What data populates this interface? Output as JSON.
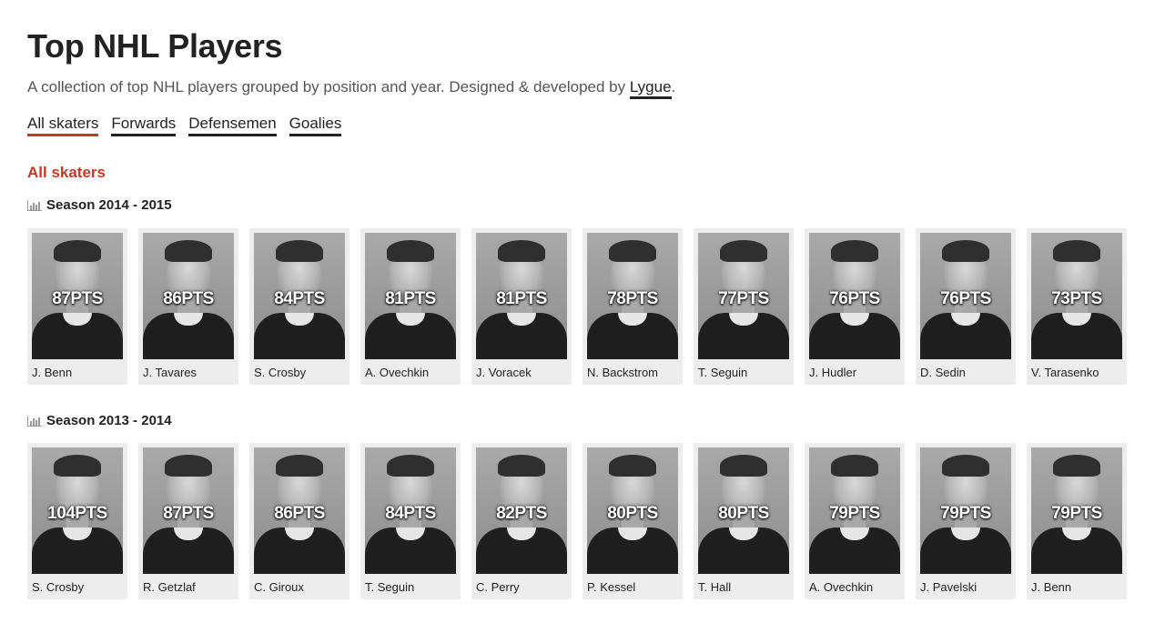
{
  "header": {
    "title": "Top NHL Players",
    "subtitle_prefix": "A collection of top NHL players grouped by position and year. Designed & developed by ",
    "subtitle_link": "Lygue",
    "subtitle_suffix": "."
  },
  "tabs": [
    {
      "label": "All skaters",
      "active": true
    },
    {
      "label": "Forwards",
      "active": false
    },
    {
      "label": "Defensemen",
      "active": false
    },
    {
      "label": "Goalies",
      "active": false
    }
  ],
  "section_title": "All skaters",
  "seasons": [
    {
      "label": "Season 2014 - 2015",
      "players": [
        {
          "points": "87PTS",
          "name": "J. Benn"
        },
        {
          "points": "86PTS",
          "name": "J. Tavares"
        },
        {
          "points": "84PTS",
          "name": "S. Crosby"
        },
        {
          "points": "81PTS",
          "name": "A. Ovechkin"
        },
        {
          "points": "81PTS",
          "name": "J. Voracek"
        },
        {
          "points": "78PTS",
          "name": "N. Backstrom"
        },
        {
          "points": "77PTS",
          "name": "T. Seguin"
        },
        {
          "points": "76PTS",
          "name": "J. Hudler"
        },
        {
          "points": "76PTS",
          "name": "D. Sedin"
        },
        {
          "points": "73PTS",
          "name": "V. Tarasenko"
        }
      ]
    },
    {
      "label": "Season 2013 - 2014",
      "players": [
        {
          "points": "104PTS",
          "name": "S. Crosby"
        },
        {
          "points": "87PTS",
          "name": "R. Getzlaf"
        },
        {
          "points": "86PTS",
          "name": "C. Giroux"
        },
        {
          "points": "84PTS",
          "name": "T. Seguin"
        },
        {
          "points": "82PTS",
          "name": "C. Perry"
        },
        {
          "points": "80PTS",
          "name": "P. Kessel"
        },
        {
          "points": "80PTS",
          "name": "T. Hall"
        },
        {
          "points": "79PTS",
          "name": "A. Ovechkin"
        },
        {
          "points": "79PTS",
          "name": "J. Pavelski"
        },
        {
          "points": "79PTS",
          "name": "J. Benn"
        }
      ]
    }
  ],
  "icons": {
    "season": "bar-chart-icon"
  },
  "colors": {
    "accent": "#c0392b",
    "text": "#222222",
    "card_bg": "#ededed"
  }
}
